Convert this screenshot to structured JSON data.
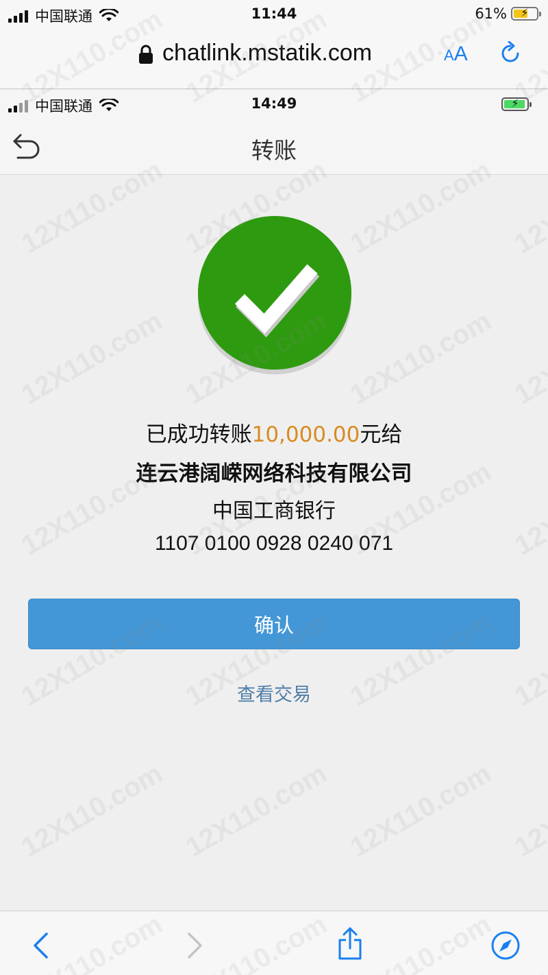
{
  "outer_status": {
    "carrier": "中国联通",
    "time": "11:44",
    "battery_percent": "61%",
    "battery_level": 0.61
  },
  "browser": {
    "url": "chatlink.mstatik.com",
    "text_size_small": "A",
    "text_size_big": "A",
    "accent_color": "#1a7ff0"
  },
  "inner_status": {
    "carrier": "中国联通",
    "time": "14:49",
    "battery_level": 0.95
  },
  "nav": {
    "title": "转账"
  },
  "result": {
    "prefix": "已成功转账",
    "amount": "10,000.00",
    "suffix": "元给",
    "recipient": "连云港阔嵘网络科技有限公司",
    "bank": "中国工商银行",
    "account": "1107 0100 0928 0240 071",
    "success_color": "#2e9a0f",
    "amount_color": "#d98b22"
  },
  "actions": {
    "confirm_label": "确认",
    "view_transaction_label": "查看交易",
    "button_color": "#4497d6"
  },
  "watermark": "12X110.com"
}
